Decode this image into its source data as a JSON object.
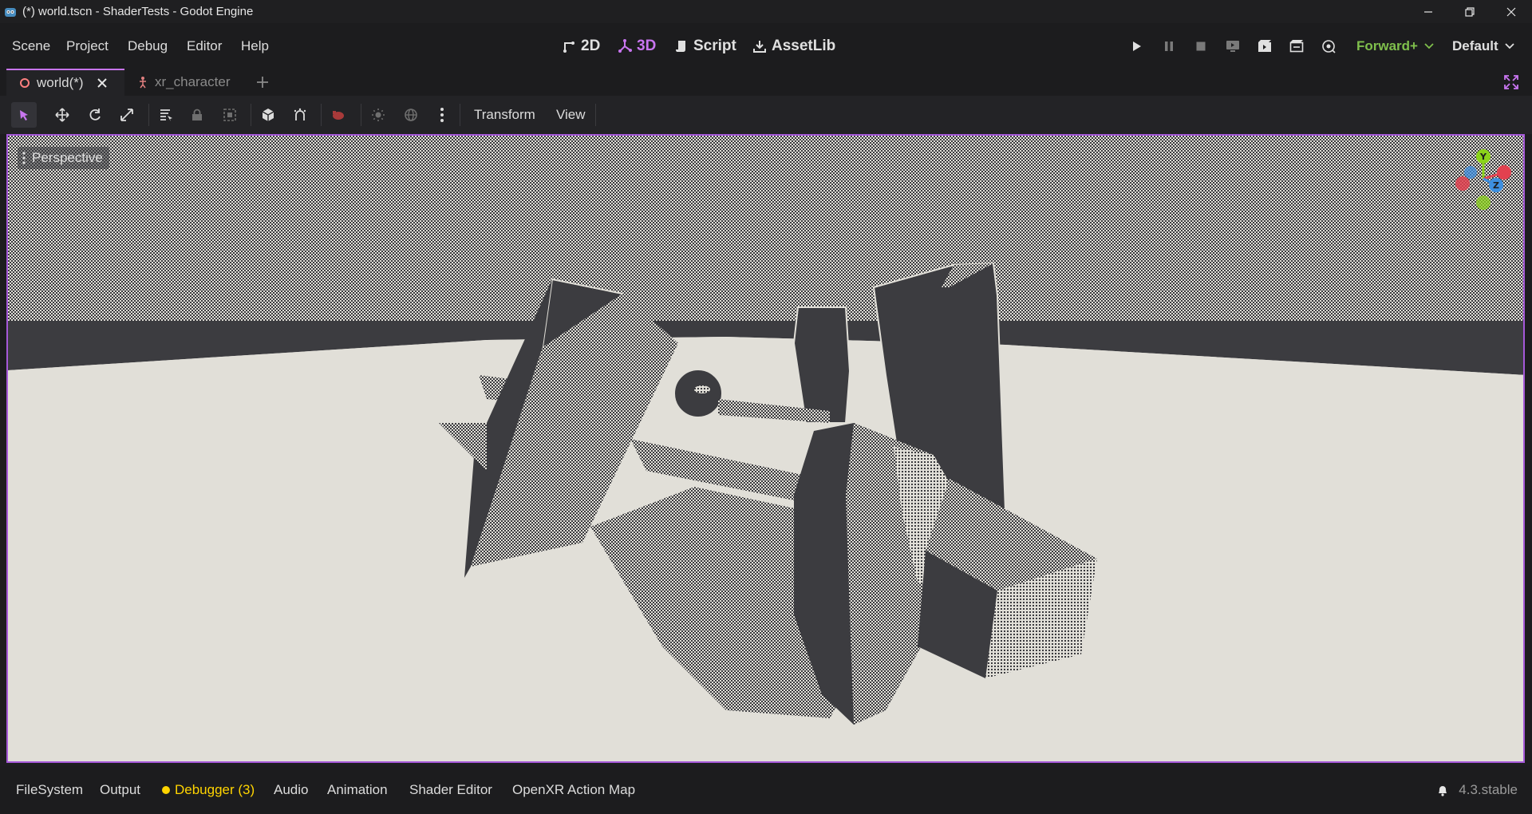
{
  "window": {
    "title": "(*) world.tscn - ShaderTests - Godot Engine",
    "minimize_icon": "minimize-icon",
    "maximize_icon": "restore-icon",
    "close_icon": "close-icon"
  },
  "menu": [
    "Scene",
    "Project",
    "Debug",
    "Editor",
    "Help"
  ],
  "main_screens": [
    {
      "label": "2D",
      "icon": "2d-icon",
      "active": false
    },
    {
      "label": "3D",
      "icon": "3d-icon",
      "active": true
    },
    {
      "label": "Script",
      "icon": "script-icon",
      "active": false
    },
    {
      "label": "AssetLib",
      "icon": "assetlib-icon",
      "active": false
    }
  ],
  "renderer": {
    "method": "Forward+",
    "layout": "Default"
  },
  "scene_tabs": [
    {
      "label": "world(*)",
      "active": true
    },
    {
      "label": "xr_character",
      "active": false
    }
  ],
  "toolbar": {
    "transform_menu": "Transform",
    "view_menu": "View"
  },
  "viewport": {
    "perspective_label": "Perspective",
    "gizmo_labels": {
      "y": "Y",
      "z": "Z"
    }
  },
  "bottom_tabs": [
    "FileSystem",
    "Output",
    "Debugger (3)",
    "Audio",
    "Animation",
    "Shader Editor",
    "OpenXR Action Map"
  ],
  "version": "4.3.stable",
  "colors": {
    "accent": "#c875f0",
    "renderer_green": "#7fbf4c",
    "debugger_dot": "#ffd400",
    "axis_x": "#e2414f",
    "axis_y": "#8bd31a",
    "axis_z": "#3d8fe0"
  }
}
